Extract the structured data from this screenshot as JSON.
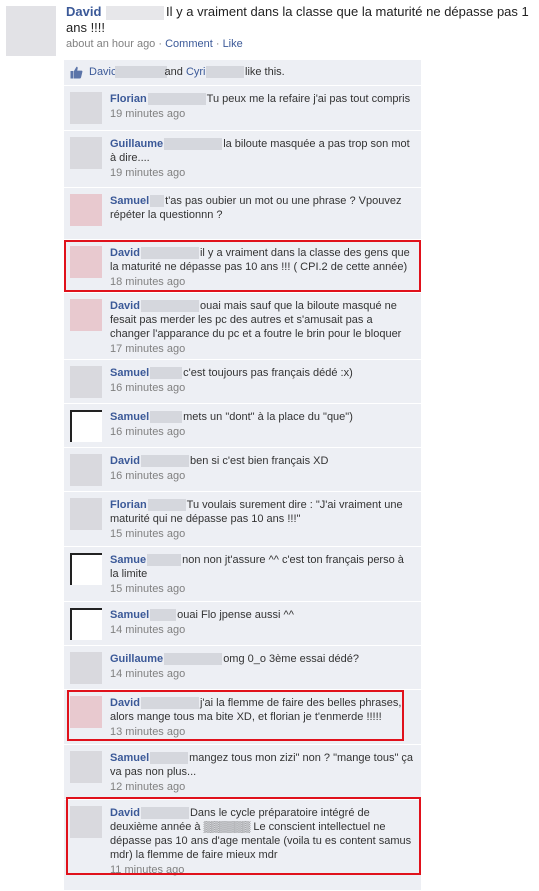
{
  "post": {
    "author": "David",
    "text": "Il y a vraiment dans la classe que la maturité ne dépasse pas 1 ans !!!!",
    "time": "about an hour ago",
    "sep1": " · ",
    "comment_link": "Comment",
    "sep2": " · ",
    "like_link": "Like"
  },
  "likes": {
    "name1": "Davic",
    "and": "and",
    "name2": "Cyril",
    "suffix": "like this."
  },
  "comments": [
    {
      "name": "Florian",
      "text": "Tu peux me la refaire j'ai pas tout compris",
      "time": "19 minutes ago"
    },
    {
      "name": "Guillaume",
      "text": "la biloute masquée a pas trop son mot à dire....",
      "time": "19 minutes ago"
    },
    {
      "name": "Samuel",
      "text": "t'as pas oubier un mot ou une phrase ? Vpouvez répéter la questionnn ?",
      "time": "19 minutes ago"
    },
    {
      "name": "David",
      "text": "il y a vraiment dans la classe des gens que la maturité ne dépasse pas 10 ans !!! ( CPI.2 de cette année)",
      "time": "18 minutes ago"
    },
    {
      "name": "David",
      "text": "ouai mais sauf que la biloute masqué ne fesait pas merder les pc des autres et s'amusait pas a changer l'apparance du pc et a foutre le brin pour le bloquer",
      "time": "17 minutes ago"
    },
    {
      "name": "Samuel",
      "text": "c'est toujours pas français dédé :x)",
      "time": "16 minutes ago"
    },
    {
      "name": "Samuel",
      "text": "mets un \"dont\" à la place du \"que\")",
      "time": "16 minutes ago"
    },
    {
      "name": "David",
      "text": "ben si c'est bien français XD",
      "time": "16 minutes ago"
    },
    {
      "name": "Florian",
      "text": "Tu voulais surement dire : \"J'ai vraiment une maturité qui ne dépasse pas 10 ans !!!\"",
      "time": "15 minutes ago"
    },
    {
      "name": "Samue",
      "text": "non non jt'assure ^^ c'est ton français perso à la limite",
      "time": "15 minutes ago"
    },
    {
      "name": "Samuel",
      "text": "ouai Flo jpense aussi ^^",
      "time": "14 minutes ago"
    },
    {
      "name": "Guillaume",
      "text": "omg 0_o 3ème essai dédé?",
      "time": "14 minutes ago"
    },
    {
      "name": "David",
      "text": "j'ai la flemme de faire des belles phrases, alors mange tous ma bite XD, et florian je t'enmerde !!!!!",
      "time": "13 minutes ago"
    },
    {
      "name": "Samuel",
      "text": "mangez tous mon zizi\" non ? \"mange tous\" ça va pas non plus...",
      "time": "12 minutes ago"
    },
    {
      "name": "David",
      "text": "Dans le cycle préparatoire intégré de deuxième année à ▒▒▒▒▒▒ Le conscient intellectuel ne dépasse pas 10 ans d'age mentale (voila tu es content samus mdr) la flemme de faire mieux mdr",
      "time": "11 minutes ago"
    }
  ]
}
